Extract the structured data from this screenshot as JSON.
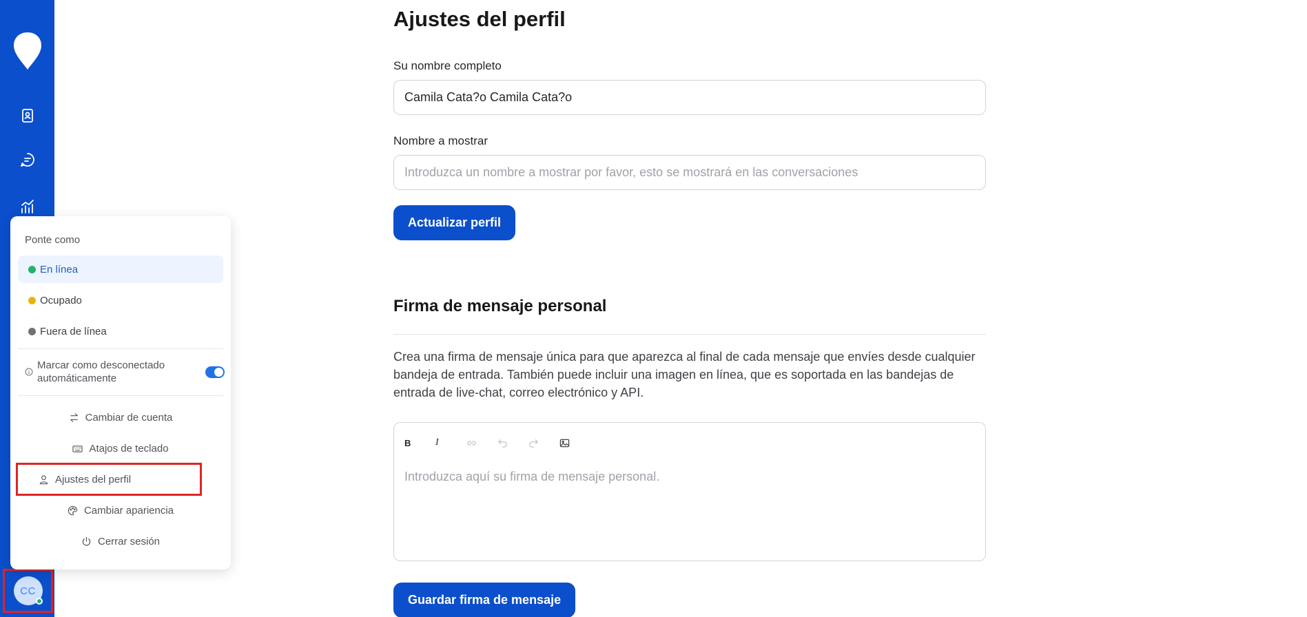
{
  "colors": {
    "brand": "#0b4fcc",
    "online": "#22b26b",
    "busy": "#eab308",
    "offline": "#71717a",
    "toggle_on": "#1f72e8",
    "highlight": "#e02424"
  },
  "sidebar": {
    "items": [
      {
        "name": "logo",
        "icon": "chat-bubble-logo-icon"
      },
      {
        "name": "contacts",
        "icon": "contacts-book-icon"
      },
      {
        "name": "conversations",
        "icon": "message-bubble-icon"
      },
      {
        "name": "reports",
        "icon": "chart-line-icon"
      }
    ],
    "avatar": {
      "initials": "CC",
      "status": "online"
    }
  },
  "status_menu": {
    "heading": "Ponte como",
    "statuses": [
      {
        "label": "En línea",
        "color": "#22b26b",
        "active": true
      },
      {
        "label": "Ocupado",
        "color": "#eab308",
        "active": false
      },
      {
        "label": "Fuera de línea",
        "color": "#71717a",
        "active": false
      }
    ],
    "auto_offline": {
      "label": "Marcar como desconectado automáticamente",
      "enabled": true
    },
    "items": [
      {
        "label": "Cambiar de cuenta",
        "icon": "arrows-swap-icon"
      },
      {
        "label": "Atajos de teclado",
        "icon": "keyboard-icon"
      },
      {
        "label": "Ajustes del perfil",
        "icon": "person-icon"
      },
      {
        "label": "Cambiar apariencia",
        "icon": "palette-icon"
      },
      {
        "label": "Cerrar sesión",
        "icon": "power-icon"
      }
    ]
  },
  "profile": {
    "title": "Ajustes del perfil",
    "full_name_label": "Su nombre completo",
    "full_name_value": "Camila Cata?o Camila Cata?o",
    "display_name_label": "Nombre a mostrar",
    "display_name_placeholder": "Introduzca un nombre a mostrar por favor, esto se mostrará en las conversaciones",
    "update_button": "Actualizar perfil"
  },
  "signature": {
    "title": "Firma de mensaje personal",
    "description": "Crea una firma de mensaje única para que aparezca al final de cada mensaje que envíes desde cualquier bandeja de entrada. También puede incluir una imagen en línea, que es soportada en las bandejas de entrada de live-chat, correo electrónico y API.",
    "toolbar": [
      {
        "name": "bold-icon",
        "glyph": "B"
      },
      {
        "name": "italic-icon",
        "glyph": "I"
      },
      {
        "name": "link-icon",
        "glyph": ""
      },
      {
        "name": "undo-icon",
        "glyph": ""
      },
      {
        "name": "redo-icon",
        "glyph": ""
      },
      {
        "name": "image-icon",
        "glyph": ""
      }
    ],
    "editor_placeholder": "Introduzca aquí su firma de mensaje personal.",
    "save_button": "Guardar firma de mensaje"
  }
}
